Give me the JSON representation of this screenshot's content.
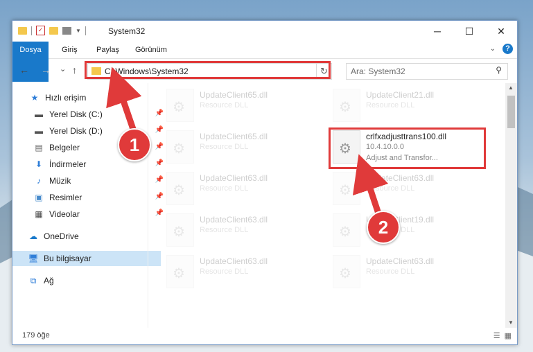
{
  "window": {
    "title": "System32",
    "controls": {
      "minimize": "─",
      "maximize": "☐",
      "close": "✕"
    }
  },
  "ribbon": {
    "tabs": [
      "Dosya",
      "Giriş",
      "Paylaş",
      "Görünüm"
    ],
    "help_icon": "?"
  },
  "navigation": {
    "back": "←",
    "forward": "→",
    "recent": "⌄",
    "up": "↑",
    "address": "C:\\Windows\\System32",
    "refresh": "↻",
    "search_placeholder": "Ara: System32"
  },
  "sidebar": {
    "items": [
      {
        "label": "Hızlı erişim",
        "icon": "star-icon",
        "pinned": false
      },
      {
        "label": "Yerel Disk (C:)",
        "icon": "drive-icon",
        "pinned": true
      },
      {
        "label": "Yerel Disk (D:)",
        "icon": "drive-icon",
        "pinned": true
      },
      {
        "label": "Belgeler",
        "icon": "document-icon",
        "pinned": true
      },
      {
        "label": "İndirmeler",
        "icon": "download-icon",
        "pinned": true
      },
      {
        "label": "Müzik",
        "icon": "music-icon",
        "pinned": true
      },
      {
        "label": "Resimler",
        "icon": "picture-icon",
        "pinned": true
      },
      {
        "label": "Videolar",
        "icon": "video-icon",
        "pinned": true
      },
      {
        "label": "OneDrive",
        "icon": "cloud-icon",
        "pinned": false
      },
      {
        "label": "Bu bilgisayar",
        "icon": "computer-icon",
        "pinned": false,
        "selected": true
      },
      {
        "label": "Ağ",
        "icon": "network-icon",
        "pinned": false
      }
    ]
  },
  "files": [
    {
      "name": "UpdateClient65.dll",
      "type": "Resource DLL"
    },
    {
      "name": "UpdateClient21.dll",
      "type": "Resource DLL"
    },
    {
      "name": "UpdateClient65.dll",
      "type": "Resource DLL"
    },
    {
      "name": "crlfxadjusttrans100.dll",
      "version": "10.4.10.0.0",
      "description": "Adjust and Transfor...",
      "highlighted": true
    },
    {
      "name": "UpdateClient63.dll",
      "type": "Resource DLL"
    },
    {
      "name": "UpdateClient63.dll",
      "type": "Resource DLL"
    },
    {
      "name": "UpdateClient63.dll",
      "type": "Resource DLL"
    },
    {
      "name": "UpdateClient19.dll",
      "type": "Resource DLL"
    },
    {
      "name": "UpdateClient63.dll",
      "type": "Resource DLL"
    },
    {
      "name": "UpdateClient63.dll",
      "type": "Resource DLL"
    }
  ],
  "status": {
    "count": "179 öğe"
  },
  "callouts": {
    "one": "1",
    "two": "2"
  },
  "colors": {
    "accent": "#1979ca",
    "highlight": "#e03a3a",
    "folder": "#f4c84d"
  }
}
